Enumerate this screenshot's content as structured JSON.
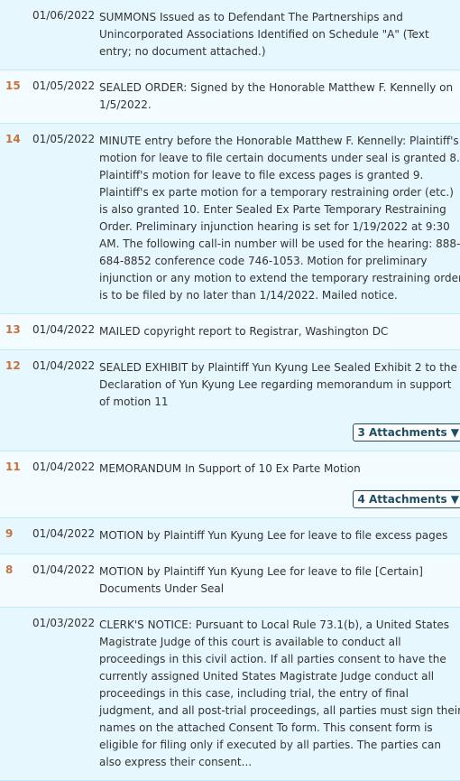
{
  "entries": [
    {
      "num": "",
      "date": "01/06/2022",
      "text": "SUMMONS Issued as to Defendant The Partnerships and Unincorporated Associations Identified on Schedule \"A\" (Text entry; no document attached.)"
    },
    {
      "num": "15",
      "date": "01/05/2022",
      "text": "SEALED ORDER: Signed by the Honorable Matthew F. Kennelly on 1/5/2022."
    },
    {
      "num": "14",
      "date": "01/05/2022",
      "text": "MINUTE entry before the Honorable Matthew F. Kennelly: Plaintiff's motion for leave to file certain documents under seal is granted 8. Plaintiff's motion for leave to file excess pages is granted 9. Plaintiff's ex parte motion for a temporary restraining order (etc.) is also granted 10. Enter Sealed Ex Parte Temporary Restraining Order. Preliminary injunction hearing is set for 1/19/2022 at 9:30 AM. The following call-in number will be used for the hearing: 888-684-8852 conference code 746-1053. Motion for preliminary injunction or any motion to extend the temporary restraining order is to be filed by no later than 1/14/2022. Mailed notice."
    },
    {
      "num": "13",
      "date": "01/04/2022",
      "text": "MAILED copyright report to Registrar, Washington DC"
    },
    {
      "num": "12",
      "date": "01/04/2022",
      "text": "SEALED EXHIBIT by Plaintiff Yun Kyung Lee Sealed Exhibit 2 to the Declaration of Yun Kyung Lee regarding memorandum in support of motion 11",
      "attachments": "3 Attachments ▼"
    },
    {
      "num": "11",
      "date": "01/04/2022",
      "text": "MEMORANDUM In Support of 10 Ex Parte Motion",
      "attachments": "4 Attachments ▼"
    },
    {
      "num": "9",
      "date": "01/04/2022",
      "text": "MOTION by Plaintiff Yun Kyung Lee for leave to file excess pages"
    },
    {
      "num": "8",
      "date": "01/04/2022",
      "text": "MOTION by Plaintiff Yun Kyung Lee for leave to file [Certain] Documents Under Seal"
    },
    {
      "num": "",
      "date": "01/03/2022",
      "text": "CLERK'S NOTICE: Pursuant to Local Rule 73.1(b), a United States Magistrate Judge of this court is available to conduct all proceedings in this civil action. If all parties consent to have the currently assigned United States Magistrate Judge conduct all proceedings in this case, including trial, the entry of final judgment, and all post-trial proceedings, all parties must sign their names on the attached Consent To form. This consent form is eligible for filing only if executed by all parties. The parties can also express their consent..."
    }
  ],
  "colors": {
    "number": "#c8733b",
    "border": "#bfe8f8",
    "row_a": "#e6f7fe",
    "row_b": "#f2fbff"
  }
}
